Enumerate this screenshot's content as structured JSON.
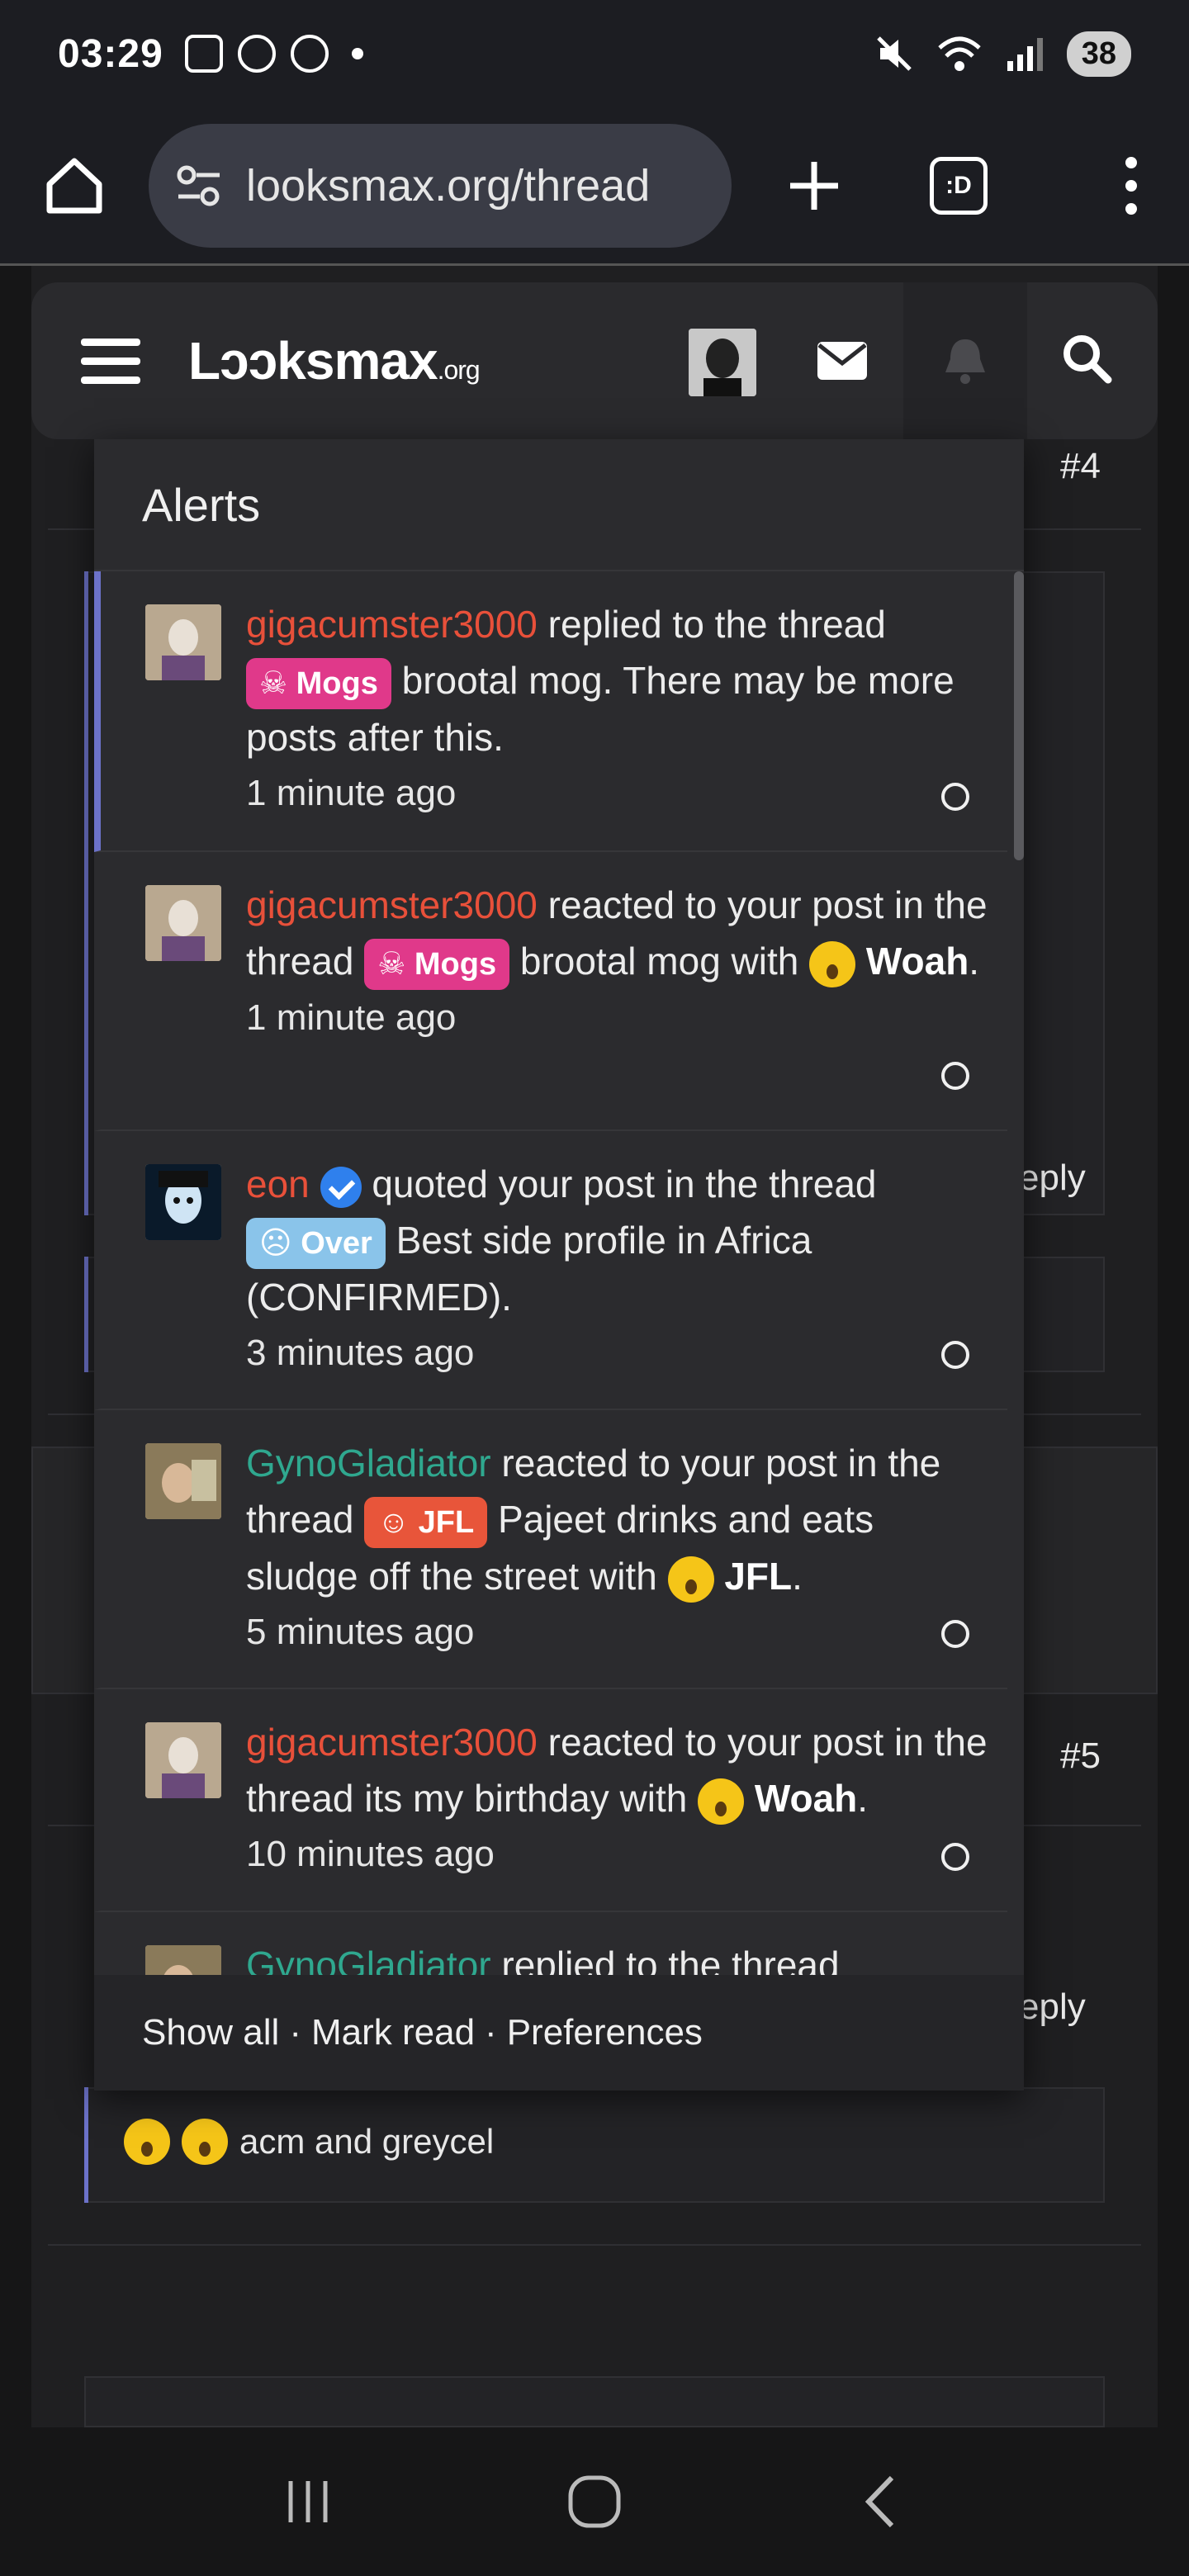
{
  "status_bar": {
    "time": "03:29",
    "battery": "38",
    "icons": [
      "screenshot-icon",
      "whatsapp-icon",
      "threads-icon",
      "mute-icon",
      "wifi-icon",
      "signal-icon"
    ]
  },
  "browser": {
    "url": "looksmax.org/thread",
    "tabs_label": ":D"
  },
  "site_header": {
    "logo_main": "Lɔɔksmax",
    "logo_suffix": ".org"
  },
  "background": {
    "post_number_1": "#4",
    "post_number_2": "#5",
    "reply_1": "eply",
    "reply_2": "eply",
    "reactions_text": "acm and greycel"
  },
  "alerts": {
    "title": "Alerts",
    "items": [
      {
        "user": "gigacumster3000",
        "action": "replied to the thread",
        "tag": "Mogs",
        "thread": "brootal mog. There may be more posts after this.",
        "time": "1 minute ago"
      },
      {
        "user": "gigacumster3000",
        "action": "reacted to your post in the thread",
        "tag": "Mogs",
        "thread": "brootal mog with",
        "reaction": "Woah",
        "time": "1 minute ago"
      },
      {
        "user": "eon",
        "action": "quoted your post in the thread",
        "tag": "Over",
        "thread": "Best side profile in Africa (CONFIRMED).",
        "time": "3 minutes ago"
      },
      {
        "user": "GynoGladiator",
        "action": "reacted to your post in the thread",
        "tag": "JFL",
        "thread": "Pajeet drinks and eats sludge off the street with",
        "reaction": "JFL",
        "time": "5 minutes ago"
      },
      {
        "user": "gigacumster3000",
        "action": "reacted to your post in the thread its my birthday with",
        "reaction": "Woah",
        "time": "10 minutes ago"
      },
      {
        "user": "GynoGladiator",
        "action": "replied to the thread"
      }
    ],
    "footer": {
      "show_all": "Show all",
      "mark_read": "Mark read",
      "preferences": "Preferences"
    }
  },
  "colors": {
    "accent": "#6c72c9",
    "username_red": "#e8503a",
    "username_green": "#2fa88f",
    "tag_mogs": "#e0398a",
    "tag_over": "#8ac4ea",
    "tag_jfl": "#e8553a"
  }
}
